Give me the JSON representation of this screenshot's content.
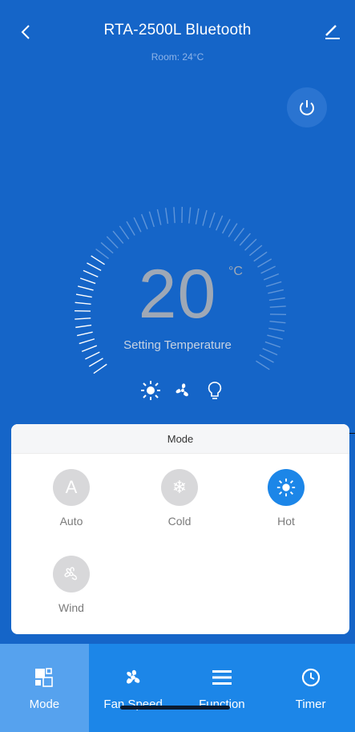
{
  "header": {
    "title": "RTA-2500L Bluetooth",
    "subtitle": "Room: 24°C",
    "back_icon": "chevron-left-icon",
    "edit_icon": "edit-icon"
  },
  "power": {
    "icon": "power-icon"
  },
  "thermostat": {
    "temperature": "20",
    "unit": "°C",
    "label": "Setting Temperature",
    "status_icons": [
      "sun-icon",
      "fan-icon",
      "bulb-icon"
    ]
  },
  "mode_panel": {
    "title": "Mode",
    "options": [
      {
        "label": "Auto",
        "glyph": "A",
        "active": false
      },
      {
        "label": "Cold",
        "glyph": "❄",
        "active": false
      },
      {
        "label": "Hot",
        "glyph": "sun",
        "active": true
      },
      {
        "label": "Wind",
        "glyph": "fan",
        "active": false
      }
    ]
  },
  "tabs": [
    {
      "label": "Mode",
      "icon": "mode-grid-icon",
      "active": true
    },
    {
      "label": "Fan Speed",
      "icon": "fan-icon",
      "active": false
    },
    {
      "label": "Function",
      "icon": "menu-icon",
      "active": false
    },
    {
      "label": "Timer",
      "icon": "clock-icon",
      "active": false
    }
  ],
  "colors": {
    "background": "#1565c8",
    "accent": "#1c86e8",
    "active_tab": "#56a2ee",
    "inactive_mode": "#d8d8da"
  }
}
